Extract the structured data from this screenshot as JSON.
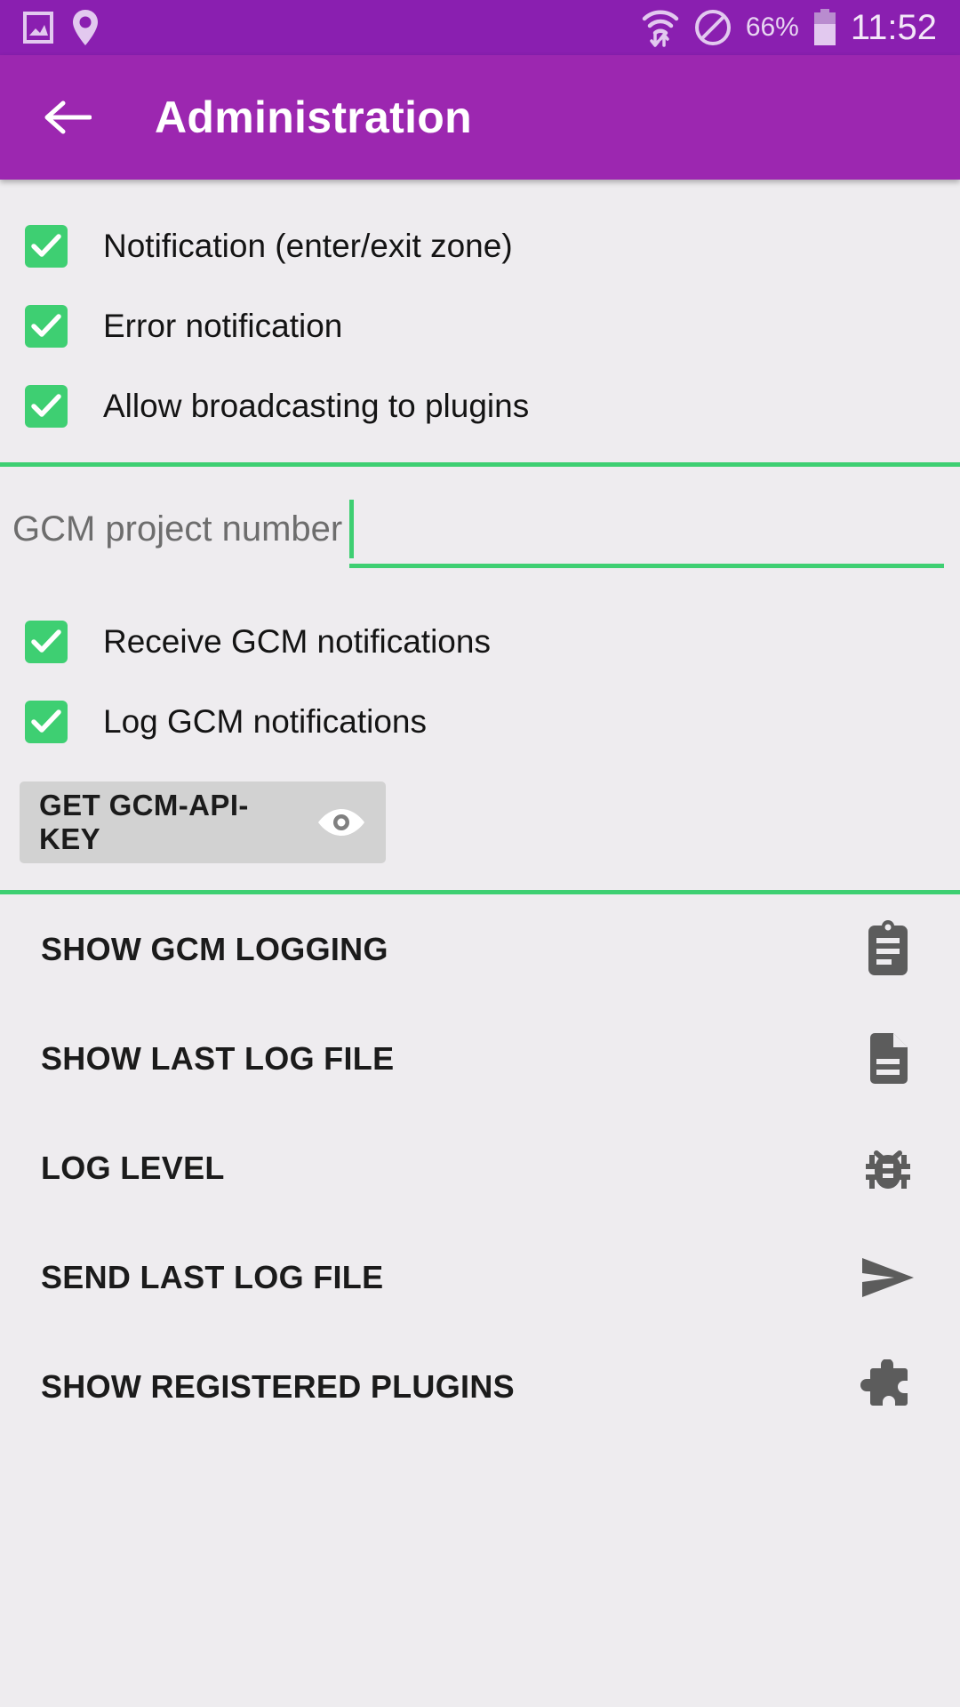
{
  "status_bar": {
    "icons_left": [
      "screenshot-icon",
      "location-pin-icon"
    ],
    "wifi_icon": "wifi-transfer-icon",
    "dnd_icon": "do-not-disturb-icon",
    "battery_percent": "66%",
    "battery_icon": "battery-icon",
    "clock": "11:52"
  },
  "app_bar": {
    "back_icon": "back-arrow-icon",
    "title": "Administration"
  },
  "colors": {
    "status_bar_bg": "#8a1fb0",
    "app_bar_bg": "#9c27b0",
    "accent_green": "#3ecf72",
    "page_bg": "#eeecef",
    "button_gray": "#d2d2d2"
  },
  "checkboxes_top": [
    {
      "label": "Notification (enter/exit zone)",
      "checked": true
    },
    {
      "label": "Error notification",
      "checked": true
    },
    {
      "label": "Allow broadcasting to plugins",
      "checked": true
    }
  ],
  "gcm_field": {
    "label": "GCM project number",
    "value": "",
    "placeholder": ""
  },
  "checkboxes_gcm": [
    {
      "label": "Receive GCM notifications",
      "checked": true
    },
    {
      "label": "Log GCM notifications",
      "checked": true
    }
  ],
  "api_key_button": {
    "label": "GET GCM-API-KEY",
    "icon": "eye-icon"
  },
  "list_items": [
    {
      "label": "SHOW GCM LOGGING",
      "icon": "clipboard-icon"
    },
    {
      "label": "SHOW LAST LOG FILE",
      "icon": "document-icon"
    },
    {
      "label": "LOG LEVEL",
      "icon": "bug-icon"
    },
    {
      "label": "SEND LAST LOG FILE",
      "icon": "send-arrow-icon"
    },
    {
      "label": "SHOW REGISTERED PLUGINS",
      "icon": "puzzle-piece-icon"
    }
  ]
}
